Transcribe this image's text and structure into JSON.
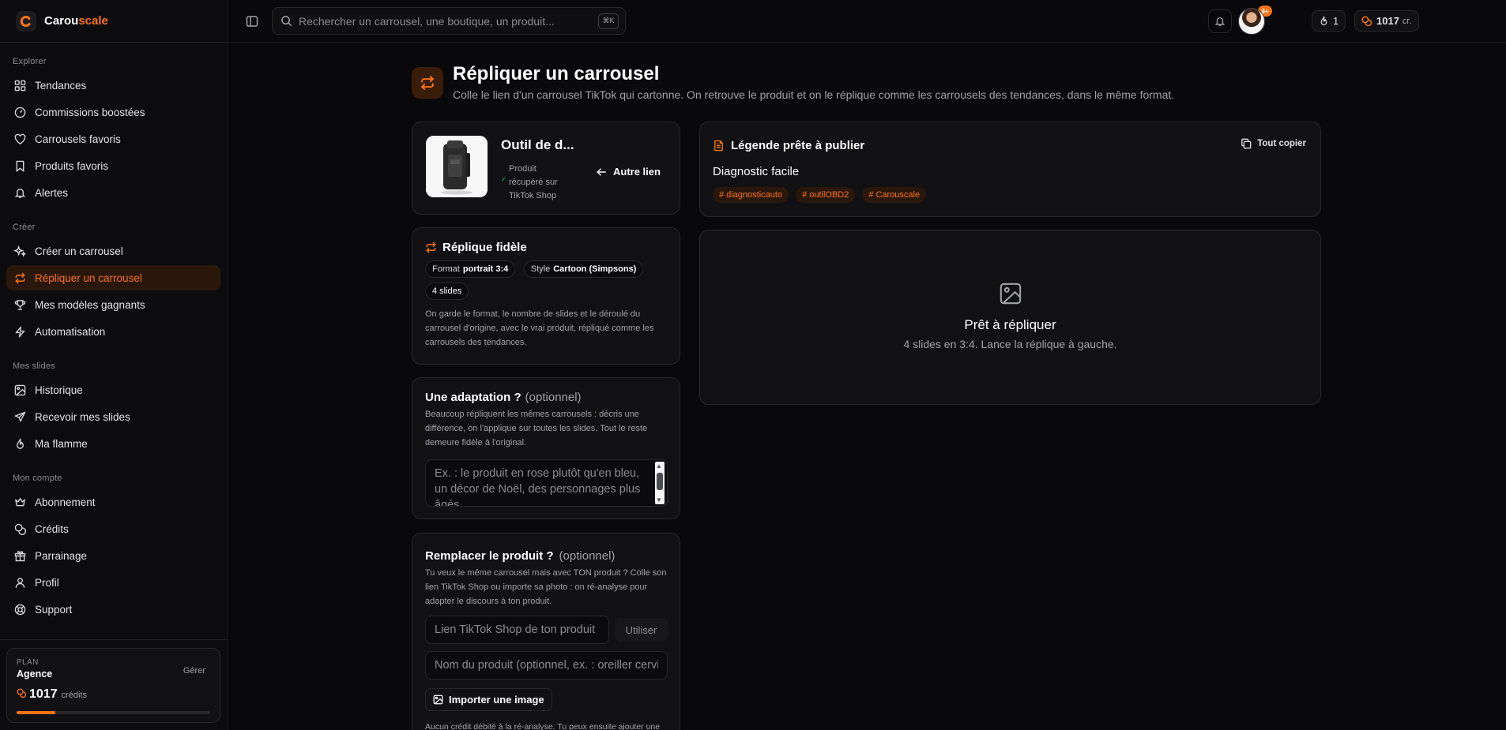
{
  "brand": {
    "name_part1": "Carou",
    "name_part2": "scale"
  },
  "search": {
    "placeholder": "Rechercher un carrousel, une boutique, un produit...",
    "shortcut": "⌘K"
  },
  "topbar": {
    "flame_count": "1",
    "credits_value": "1017",
    "credits_unit": "cr.",
    "notifications_badge": "9+"
  },
  "sidebar": {
    "sections": [
      {
        "title": "Explorer",
        "items": [
          {
            "label": "Tendances",
            "icon": "grid-icon"
          },
          {
            "label": "Commissions boostées",
            "icon": "gauge-icon"
          },
          {
            "label": "Carrousels favoris",
            "icon": "heart-icon"
          },
          {
            "label": "Produits favoris",
            "icon": "bookmark-icon"
          },
          {
            "label": "Alertes",
            "icon": "bell-icon"
          }
        ]
      },
      {
        "title": "Créer",
        "items": [
          {
            "label": "Créer un carrousel",
            "icon": "sparkles-icon"
          },
          {
            "label": "Répliquer un carrousel",
            "icon": "repeat-icon",
            "active": true
          },
          {
            "label": "Mes modèles gagnants",
            "icon": "trophy-icon"
          },
          {
            "label": "Automatisation",
            "icon": "zap-icon"
          }
        ]
      },
      {
        "title": "Mes slides",
        "items": [
          {
            "label": "Historique",
            "icon": "image-icon"
          },
          {
            "label": "Recevoir mes slides",
            "icon": "send-icon"
          },
          {
            "label": "Ma flamme",
            "icon": "flame-icon"
          }
        ]
      },
      {
        "title": "Mon compte",
        "items": [
          {
            "label": "Abonnement",
            "icon": "crown-icon"
          },
          {
            "label": "Crédits",
            "icon": "coins-icon"
          },
          {
            "label": "Parrainage",
            "icon": "gift-icon"
          },
          {
            "label": "Profil",
            "icon": "user-icon"
          },
          {
            "label": "Support",
            "icon": "lifebuoy-icon"
          }
        ]
      }
    ],
    "plan": {
      "label": "PLAN",
      "name": "Agence",
      "manage": "Gérer",
      "credits": "1017",
      "credits_unit": "crédits",
      "usage_fraction": 0.2
    }
  },
  "page": {
    "title": "Répliquer un carrousel",
    "subtitle": "Colle le lien d'un carrousel TikTok qui cartonne. On retrouve le produit et on le réplique comme les carrousels des tendances, dans le même format."
  },
  "product": {
    "name": "Outil de d...",
    "status_line1": "Produit",
    "status_line2": "récupéré sur",
    "status_line3": "TikTok Shop",
    "other_link": "Autre lien"
  },
  "replica": {
    "title": "Réplique fidèle",
    "format_label": "Format",
    "format_value": "portrait 3:4",
    "style_label": "Style",
    "style_value": "Cartoon (Simpsons)",
    "slides": "4 slides",
    "description": "On garde le format, le nombre de slides et le déroulé du carrousel d'origine, avec le vrai produit, répliqué comme les carrousels des tendances."
  },
  "adaptation": {
    "title": "Une adaptation ?",
    "optional": "(optionnel)",
    "description": "Beaucoup répliquent les mêmes carrousels : décris une différence, on l'applique sur toutes les slides. Tout le reste demeure fidèle à l'original.",
    "placeholder": "Ex. : le produit en rose plutôt qu'en bleu, un décor de Noël, des personnages plus âgés"
  },
  "replace": {
    "title": "Remplacer le produit ?",
    "optional": "(optionnel)",
    "description": "Tu veux le même carrousel mais avec TON produit ? Colle son lien TikTok Shop ou importe sa photo : on ré-analyse pour adapter le discours à ton produit.",
    "link_placeholder": "Lien TikTok Shop de ton produit",
    "use_button": "Utiliser",
    "name_placeholder": "Nom du produit (optionnel, ex. : oreiller cervical)",
    "import_button": "Importer une image",
    "footer": "Aucun crédit débité à la ré-analyse. Tu peux ensuite ajouter une"
  },
  "caption": {
    "title": "Légende prête à publier",
    "copy_all": "Tout copier",
    "text": "Diagnostic facile",
    "tags": [
      "diagnosticauto",
      "outilOBD2",
      "Carouscale"
    ]
  },
  "preview": {
    "title": "Prêt à répliquer",
    "subtitle": "4 slides en 3:4. Lance la réplique à gauche."
  },
  "colors": {
    "accent": "#f97316",
    "background": "#09090b",
    "card": "#111113"
  }
}
